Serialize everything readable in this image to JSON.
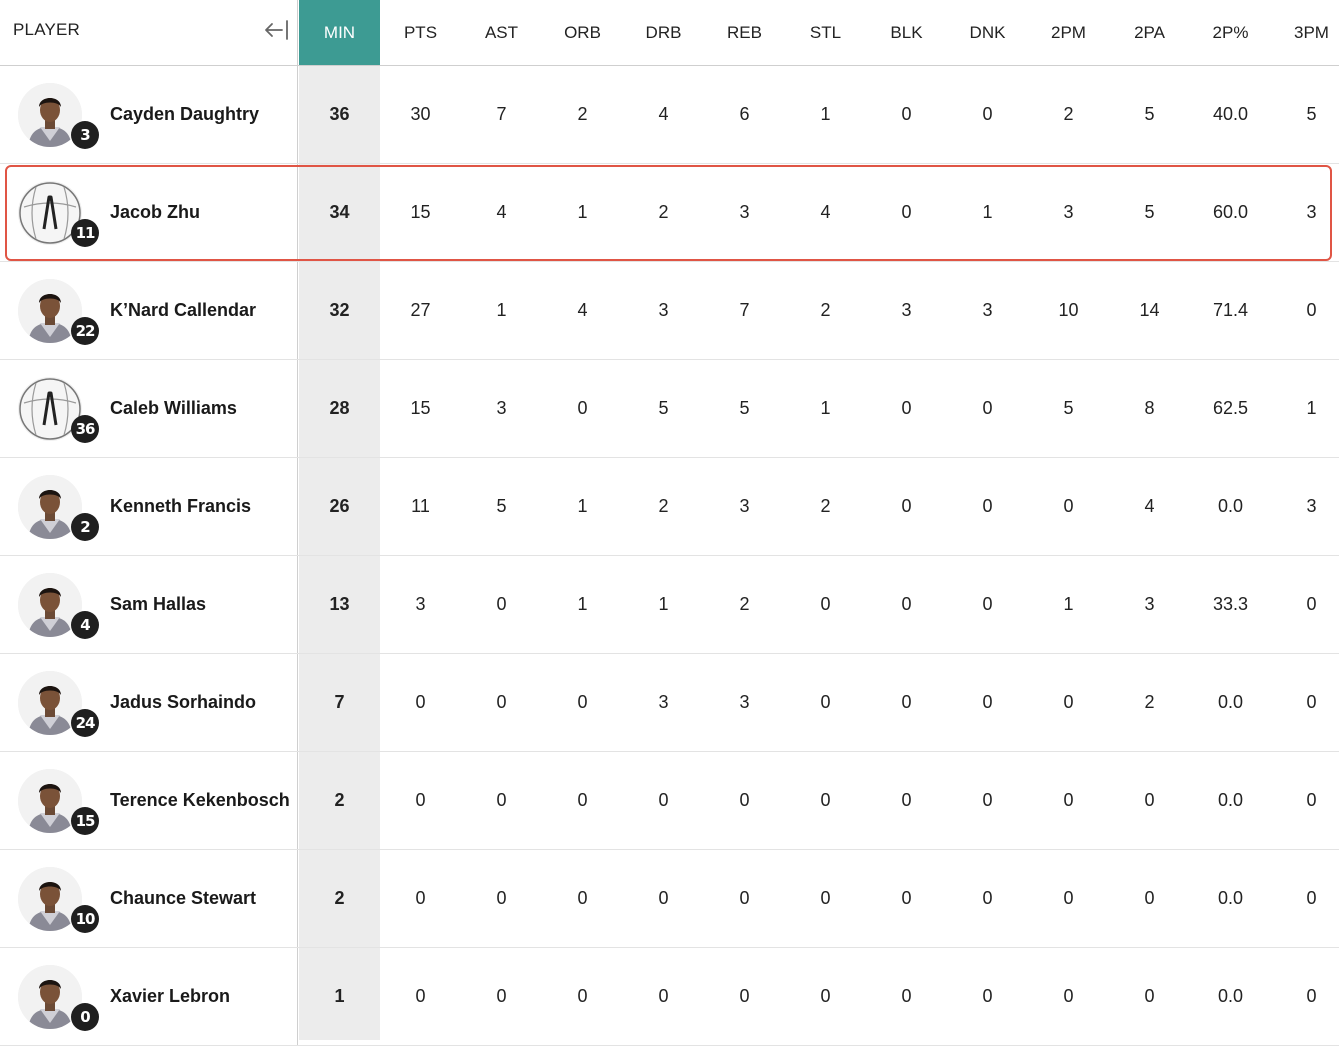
{
  "header": {
    "player_label": "PLAYER",
    "columns": [
      "MIN",
      "PTS",
      "AST",
      "ORB",
      "DRB",
      "REB",
      "STL",
      "BLK",
      "DNK",
      "2PM",
      "2PA",
      "2P%",
      "3PM"
    ]
  },
  "colors": {
    "accent": "#3d9b93",
    "highlight_border": "#e05545",
    "badge": "#1f1f1f"
  },
  "rows": [
    {
      "name": "Cayden Daughtry",
      "number": "3",
      "avatar": "player-photo",
      "stats": [
        "36",
        "30",
        "7",
        "2",
        "4",
        "6",
        "1",
        "0",
        "0",
        "2",
        "5",
        "40.0",
        "5"
      ]
    },
    {
      "name": "Jacob Zhu",
      "number": "11",
      "avatar": "team-logo",
      "stats": [
        "34",
        "15",
        "4",
        "1",
        "2",
        "3",
        "4",
        "0",
        "1",
        "3",
        "5",
        "60.0",
        "3"
      ]
    },
    {
      "name": "K’Nard Callendar",
      "number": "22",
      "avatar": "player-photo",
      "stats": [
        "32",
        "27",
        "1",
        "4",
        "3",
        "7",
        "2",
        "3",
        "3",
        "10",
        "14",
        "71.4",
        "0"
      ]
    },
    {
      "name": "Caleb Williams",
      "number": "36",
      "avatar": "team-logo",
      "stats": [
        "28",
        "15",
        "3",
        "0",
        "5",
        "5",
        "1",
        "0",
        "0",
        "5",
        "8",
        "62.5",
        "1"
      ]
    },
    {
      "name": "Kenneth Francis",
      "number": "2",
      "avatar": "player-photo",
      "stats": [
        "26",
        "11",
        "5",
        "1",
        "2",
        "3",
        "2",
        "0",
        "0",
        "0",
        "4",
        "0.0",
        "3"
      ]
    },
    {
      "name": "Sam Hallas",
      "number": "4",
      "avatar": "player-photo",
      "stats": [
        "13",
        "3",
        "0",
        "1",
        "1",
        "2",
        "0",
        "0",
        "0",
        "1",
        "3",
        "33.3",
        "0"
      ]
    },
    {
      "name": "Jadus Sorhaindo",
      "number": "24",
      "avatar": "player-photo",
      "stats": [
        "7",
        "0",
        "0",
        "0",
        "3",
        "3",
        "0",
        "0",
        "0",
        "0",
        "2",
        "0.0",
        "0"
      ]
    },
    {
      "name": "Terence Kekenbosch",
      "number": "15",
      "avatar": "player-photo",
      "stats": [
        "2",
        "0",
        "0",
        "0",
        "0",
        "0",
        "0",
        "0",
        "0",
        "0",
        "0",
        "0.0",
        "0"
      ]
    },
    {
      "name": "Chaunce Stewart",
      "number": "10",
      "avatar": "player-photo",
      "stats": [
        "2",
        "0",
        "0",
        "0",
        "0",
        "0",
        "0",
        "0",
        "0",
        "0",
        "0",
        "0.0",
        "0"
      ]
    },
    {
      "name": "Xavier Lebron",
      "number": "0",
      "avatar": "player-photo",
      "stats": [
        "1",
        "0",
        "0",
        "0",
        "0",
        "0",
        "0",
        "0",
        "0",
        "0",
        "0",
        "0.0",
        "0"
      ]
    }
  ]
}
